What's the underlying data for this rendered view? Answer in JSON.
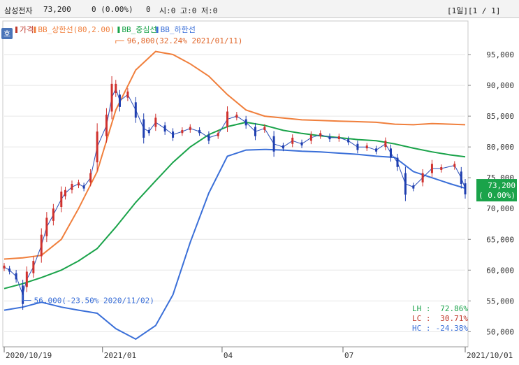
{
  "header": {
    "stock_name": "삼성전자",
    "price": "73,200",
    "change": "0 (0.00%)",
    "volume": "0",
    "ohlc": "시:0 고:0 저:0",
    "period": "[1일][1 / 1]"
  },
  "badge": "호",
  "legend": [
    {
      "label": "가격",
      "color": "#c0392b"
    },
    {
      "label": "BB_상한선(80,2.00)",
      "color": "#f07f3c"
    },
    {
      "label": "BB_중심선",
      "color": "#1aa34a"
    },
    {
      "label": "BB_하한선",
      "color": "#3a6fd8"
    }
  ],
  "annotations": {
    "high": "96,800(32.24% 2021/01/11)",
    "low": "56,000(-23.50% 2020/11/02)"
  },
  "stats": [
    {
      "label": "LH :",
      "value": "72.86%",
      "color": "#1aa34a"
    },
    {
      "label": "LC :",
      "value": "30.71%",
      "color": "#c0392b"
    },
    {
      "label": "HC :",
      "value": "-24.38%",
      "color": "#3a6fd8"
    }
  ],
  "last_price_tag": {
    "price": "73,200",
    "change": "( 0.00%)",
    "color": "#1aa34a"
  },
  "chart_data": {
    "type": "line",
    "ylim": [
      48000,
      100000
    ],
    "y_ticks": [
      50000,
      55000,
      60000,
      65000,
      70000,
      75000,
      80000,
      85000,
      90000,
      95000
    ],
    "y_tick_labels": [
      "50,000",
      "55,000",
      "60,000",
      "65,000",
      "70,000",
      "75,000",
      "80,000",
      "85,000",
      "90,000",
      "95,000"
    ],
    "x_ticks": [
      {
        "date": "2020-10-19",
        "label": "2020/10/19"
      },
      {
        "date": "2021-01-01",
        "label": "2021/01"
      },
      {
        "date": "2021-04-01",
        "label": "04"
      },
      {
        "date": "2021-07-01",
        "label": "07"
      },
      {
        "date": "2021-10-01",
        "label": "2021/10/01"
      }
    ],
    "x_range": [
      "2020-10-19",
      "2021-10-01"
    ],
    "price_series": {
      "name": "가격",
      "x": [
        "2020-10-19",
        "2020-10-23",
        "2020-10-28",
        "2020-11-02",
        "2020-11-05",
        "2020-11-10",
        "2020-11-16",
        "2020-11-20",
        "2020-11-25",
        "2020-12-01",
        "2020-12-04",
        "2020-12-09",
        "2020-12-14",
        "2020-12-18",
        "2020-12-23",
        "2020-12-28",
        "2021-01-04",
        "2021-01-08",
        "2021-01-11",
        "2021-01-14",
        "2021-01-20",
        "2021-01-26",
        "2021-02-01",
        "2021-02-05",
        "2021-02-10",
        "2021-02-17",
        "2021-02-23",
        "2021-03-02",
        "2021-03-08",
        "2021-03-15",
        "2021-03-22",
        "2021-03-29",
        "2021-04-05",
        "2021-04-12",
        "2021-04-19",
        "2021-04-26",
        "2021-05-03",
        "2021-05-10",
        "2021-05-17",
        "2021-05-24",
        "2021-05-31",
        "2021-06-07",
        "2021-06-14",
        "2021-06-21",
        "2021-06-28",
        "2021-07-05",
        "2021-07-12",
        "2021-07-19",
        "2021-07-26",
        "2021-08-02",
        "2021-08-06",
        "2021-08-11",
        "2021-08-17",
        "2021-08-23",
        "2021-08-30",
        "2021-09-06",
        "2021-09-13",
        "2021-09-23",
        "2021-09-28",
        "2021-10-01"
      ],
      "values": [
        60500,
        60000,
        59000,
        56000,
        58500,
        60500,
        64000,
        67000,
        69000,
        71500,
        72500,
        73500,
        74000,
        73500,
        75000,
        80000,
        83500,
        88000,
        89500,
        87500,
        88500,
        86000,
        83000,
        82500,
        84000,
        83000,
        82000,
        82500,
        83000,
        82500,
        81500,
        82000,
        84500,
        85000,
        84000,
        82500,
        83000,
        80500,
        80000,
        81000,
        80500,
        81500,
        82000,
        81500,
        81500,
        81000,
        80000,
        80000,
        79500,
        80500,
        79000,
        77500,
        74000,
        73500,
        75000,
        76500,
        76500,
        77000,
        75000,
        73200
      ]
    },
    "bb_upper": {
      "name": "BB_상한선",
      "x": [
        "2020-10-19",
        "2020-11-02",
        "2020-11-16",
        "2020-12-01",
        "2020-12-14",
        "2020-12-28",
        "2021-01-11",
        "2021-01-26",
        "2021-02-10",
        "2021-02-23",
        "2021-03-08",
        "2021-03-22",
        "2021-04-05",
        "2021-04-19",
        "2021-05-03",
        "2021-05-17",
        "2021-05-31",
        "2021-06-14",
        "2021-06-28",
        "2021-07-12",
        "2021-07-26",
        "2021-08-09",
        "2021-08-23",
        "2021-09-06",
        "2021-09-20",
        "2021-10-01"
      ],
      "values": [
        61800,
        62000,
        62400,
        65000,
        70000,
        76000,
        86000,
        92500,
        95500,
        95000,
        93500,
        91500,
        88500,
        86000,
        85000,
        84700,
        84400,
        84300,
        84200,
        84100,
        84000,
        83700,
        83600,
        83800,
        83700,
        83600
      ]
    },
    "bb_middle": {
      "name": "BB_중심선",
      "x": [
        "2020-10-19",
        "2020-11-02",
        "2020-11-16",
        "2020-12-01",
        "2020-12-14",
        "2020-12-28",
        "2021-01-11",
        "2021-01-26",
        "2021-02-10",
        "2021-02-23",
        "2021-03-08",
        "2021-03-22",
        "2021-04-05",
        "2021-04-19",
        "2021-05-03",
        "2021-05-17",
        "2021-05-31",
        "2021-06-14",
        "2021-06-28",
        "2021-07-12",
        "2021-07-26",
        "2021-08-09",
        "2021-08-23",
        "2021-09-06",
        "2021-09-20",
        "2021-10-01"
      ],
      "values": [
        57000,
        57800,
        58800,
        60000,
        61500,
        63500,
        67000,
        71000,
        74500,
        77500,
        80000,
        82000,
        83300,
        84000,
        83500,
        82700,
        82200,
        81800,
        81500,
        81200,
        81000,
        80500,
        79800,
        79200,
        78700,
        78400
      ]
    },
    "bb_lower": {
      "name": "BB_하한선",
      "x": [
        "2020-10-19",
        "2020-11-02",
        "2020-11-16",
        "2020-12-01",
        "2020-12-14",
        "2020-12-28",
        "2021-01-11",
        "2021-01-26",
        "2021-02-10",
        "2021-02-23",
        "2021-03-08",
        "2021-03-22",
        "2021-04-05",
        "2021-04-19",
        "2021-05-03",
        "2021-05-17",
        "2021-05-31",
        "2021-06-14",
        "2021-06-28",
        "2021-07-12",
        "2021-07-26",
        "2021-08-09",
        "2021-08-23",
        "2021-09-06",
        "2021-09-20",
        "2021-10-01"
      ],
      "values": [
        53500,
        54000,
        54800,
        54000,
        53500,
        53000,
        50500,
        48800,
        51000,
        56000,
        64500,
        72500,
        78500,
        79500,
        79600,
        79500,
        79300,
        79200,
        79000,
        78800,
        78500,
        78300,
        76000,
        75000,
        74000,
        73300
      ]
    }
  }
}
